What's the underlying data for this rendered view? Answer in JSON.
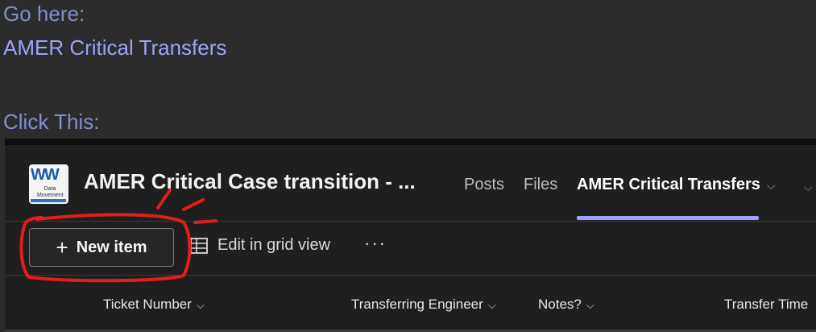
{
  "instructions": {
    "go_here_label": "Go here:",
    "link_text": "AMER Critical Transfers",
    "click_label": "Click This:"
  },
  "team": {
    "logo_text_top": "WW",
    "logo_text_bottom": "Data Movement",
    "title": "AMER Critical Case transition - ..."
  },
  "tabs": {
    "posts": "Posts",
    "files": "Files",
    "active": "AMER Critical Transfers",
    "active_chevron": "⌵"
  },
  "toolbar": {
    "new_item_icon": "+",
    "new_item_label": "New item",
    "edit_grid_label": "Edit in grid view",
    "more_label": "···"
  },
  "columns": {
    "ticket": "Ticket Number",
    "engineer": "Transferring Engineer",
    "notes": "Notes?",
    "time": "Transfer Time",
    "chevron": "⌵"
  },
  "colors": {
    "accent": "#9ea2ff",
    "annotation": "#e01e1e",
    "background": "#2d2c2c"
  }
}
